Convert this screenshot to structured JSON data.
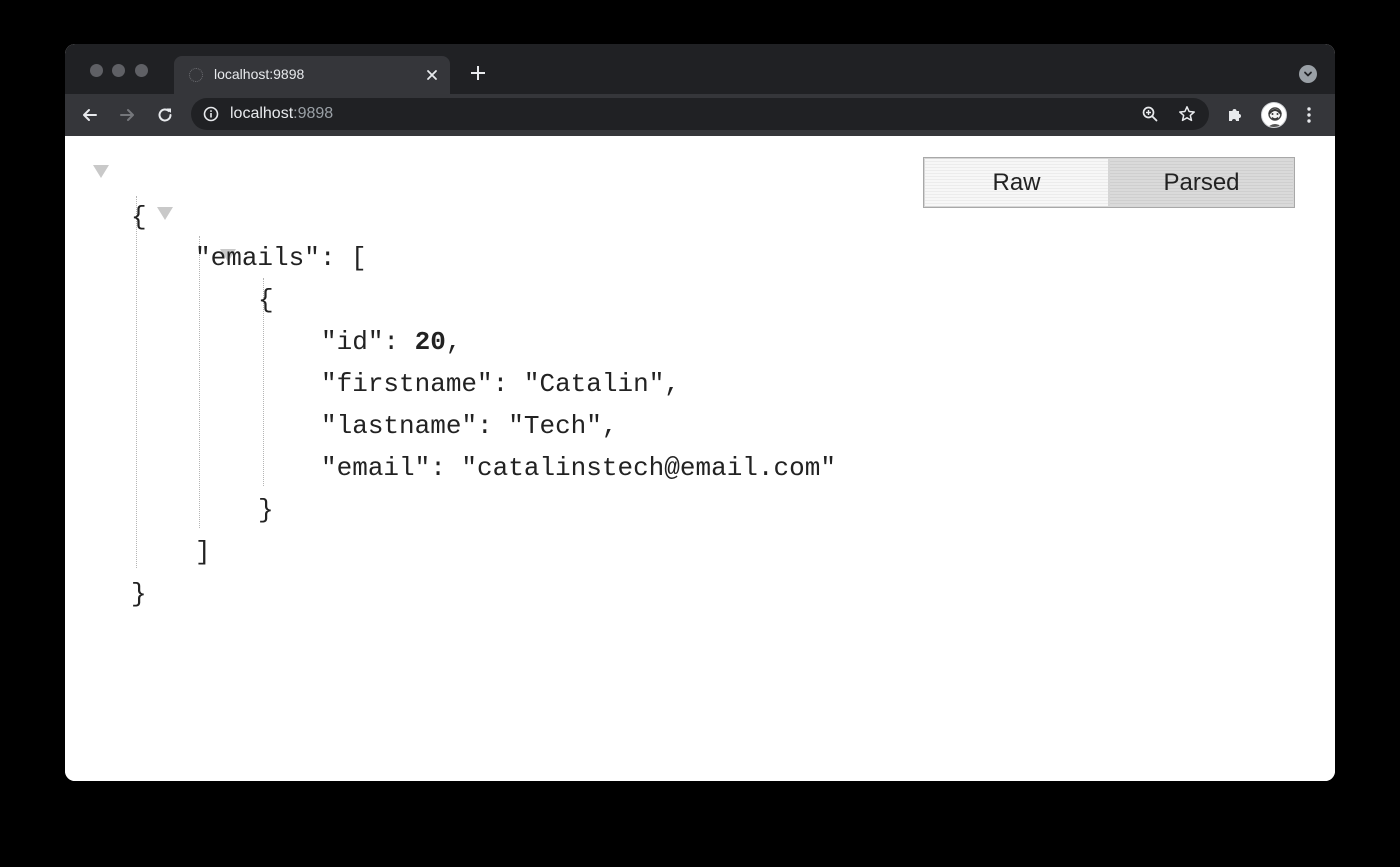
{
  "browser": {
    "tab": {
      "title": "localhost:9898"
    },
    "omnibox": {
      "host": "localhost",
      "port": ":9898"
    },
    "icons": {
      "back": "arrow-left-icon",
      "forward": "arrow-right-icon",
      "reload": "reload-icon",
      "info": "info-icon",
      "zoom": "zoom-icon",
      "bookmark": "star-icon",
      "extensions": "puzzle-icon",
      "menu": "kebab-menu-icon",
      "tab_search": "chevron-down-icon"
    }
  },
  "viewer": {
    "raw_label": "Raw",
    "parsed_label": "Parsed",
    "active_mode": "Parsed"
  },
  "json": {
    "root_key": "emails",
    "entries": [
      {
        "key": "id",
        "value": "20"
      },
      {
        "key": "firstname",
        "value": "Catalin"
      },
      {
        "key": "lastname",
        "value": "Tech"
      },
      {
        "key": "email",
        "value": "catalinstech@email.com"
      }
    ]
  }
}
